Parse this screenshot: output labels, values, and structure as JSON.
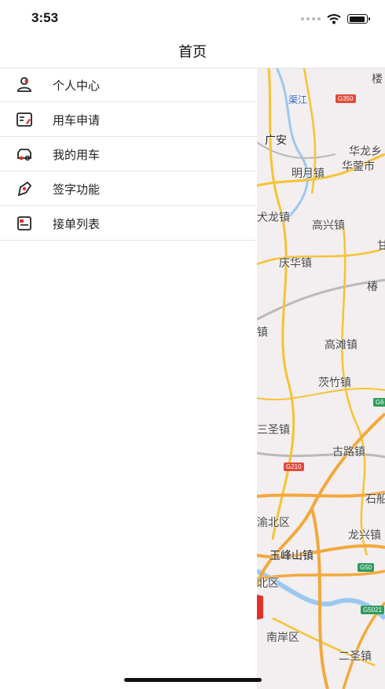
{
  "status_bar": {
    "time": "3:53"
  },
  "nav": {
    "title": "首页"
  },
  "menu": {
    "items": [
      {
        "label": "个人中心",
        "icon": "person-icon"
      },
      {
        "label": "用车申请",
        "icon": "apply-form-icon"
      },
      {
        "label": "我的用车",
        "icon": "car-icon"
      },
      {
        "label": "签字功能",
        "icon": "pen-icon"
      },
      {
        "label": "接单列表",
        "icon": "order-list-icon"
      }
    ]
  },
  "map": {
    "labels": {
      "qujiang": "渠江",
      "guangan": "广安",
      "huanglong": "华龙乡",
      "mingyue": "明月镇",
      "huaying": "华蓥市",
      "wulong": "犬龙镇",
      "gaoxing": "高兴镇",
      "qinghua": "庆华镇",
      "chun": "椿",
      "zhen": "镇",
      "gaotan": "高滩镇",
      "cizhu": "茨竹镇",
      "sansheng": "三圣镇",
      "gulu": "古路镇",
      "shi": "石船",
      "yubei": "渝北区",
      "longxing": "龙兴镇",
      "yufengshan": "玉峰山镇",
      "beiqu": "北区",
      "nanan": "南岸区",
      "ersheng": "二圣镇",
      "lou": "楼",
      "gan": "甘"
    },
    "badges": {
      "g350": "G350",
      "g210": "G210",
      "g65": "G6",
      "g50": "G50",
      "g5021": "G5021"
    },
    "colors": {
      "road": "#f7c331",
      "highway": "#f2a93b",
      "river": "#9cc8f0",
      "rail": "#b9b9b9"
    }
  }
}
